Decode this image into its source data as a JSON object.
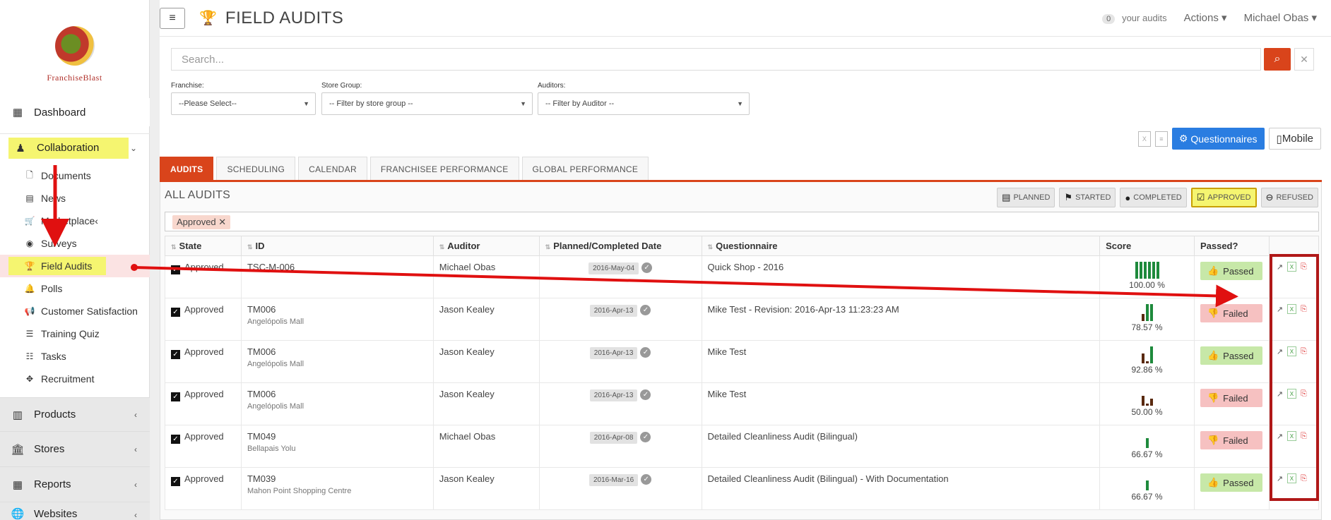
{
  "sidebar": {
    "logo_text": "FranchiseBlast",
    "items": [
      {
        "label": "Dashboard",
        "icon": "dashboard-icon"
      },
      {
        "label": "Collaboration",
        "icon": "collaboration-icon"
      }
    ],
    "sub_items": [
      {
        "label": "Documents",
        "icon": "document-icon"
      },
      {
        "label": "News",
        "icon": "newspaper-icon"
      },
      {
        "label": "Marketplace",
        "icon": "cart-icon"
      },
      {
        "label": "Surveys",
        "icon": "survey-icon"
      },
      {
        "label": "Field Audits",
        "icon": "trophy-icon"
      },
      {
        "label": "Polls",
        "icon": "bell-icon"
      },
      {
        "label": "Customer Satisfaction",
        "icon": "megaphone-icon"
      },
      {
        "label": "Training Quiz",
        "icon": "list-icon"
      },
      {
        "label": "Tasks",
        "icon": "tasks-icon"
      },
      {
        "label": "Recruitment",
        "icon": "crosshair-icon"
      }
    ],
    "sections": [
      {
        "label": "Products",
        "icon": "barcode-icon"
      },
      {
        "label": "Stores",
        "icon": "bank-icon"
      },
      {
        "label": "Reports",
        "icon": "table-icon"
      },
      {
        "label": "Websites",
        "icon": "globe-icon"
      }
    ]
  },
  "header": {
    "title": "FIELD AUDITS",
    "audit_count": "0",
    "your_audits": "your audits",
    "actions": "Actions",
    "user": "Michael Obas"
  },
  "search": {
    "placeholder": "Search..."
  },
  "filters": [
    {
      "label": "Franchise:",
      "value": "--Please Select--"
    },
    {
      "label": "Store Group:",
      "value": "-- Filter by store group --"
    },
    {
      "label": "Auditors:",
      "value": "-- Filter by Auditor --"
    }
  ],
  "toolbar": {
    "questionnaires": "Questionnaires",
    "mobile": "Mobile"
  },
  "tabs": [
    "AUDITS",
    "SCHEDULING",
    "CALENDAR",
    "FRANCHISEE PERFORMANCE",
    "GLOBAL PERFORMANCE"
  ],
  "panel": {
    "title": "ALL AUDITS",
    "status_filters": [
      "PLANNED",
      "STARTED",
      "COMPLETED",
      "APPROVED",
      "REFUSED"
    ],
    "active_tag": "Approved"
  },
  "table": {
    "columns": [
      "State",
      "ID",
      "Auditor",
      "Planned/Completed Date",
      "Questionnaire",
      "Score",
      "Passed?"
    ],
    "rows": [
      {
        "state": "Approved",
        "id": "TSC-M-006",
        "store": "",
        "auditor": "Michael Obas",
        "date": "2016-May-04",
        "questionnaire": "Quick Shop - 2016",
        "score": "100.00 %",
        "passed": "Passed"
      },
      {
        "state": "Approved",
        "id": "TM006",
        "store": "Angelópolis Mall",
        "auditor": "Jason Kealey",
        "date": "2016-Apr-13",
        "questionnaire": "Mike Test - Revision: 2016-Apr-13 11:23:23 AM",
        "score": "78.57 %",
        "passed": "Failed"
      },
      {
        "state": "Approved",
        "id": "TM006",
        "store": "Angelópolis Mall",
        "auditor": "Jason Kealey",
        "date": "2016-Apr-13",
        "questionnaire": "Mike Test",
        "score": "92.86 %",
        "passed": "Passed"
      },
      {
        "state": "Approved",
        "id": "TM006",
        "store": "Angelópolis Mall",
        "auditor": "Jason Kealey",
        "date": "2016-Apr-13",
        "questionnaire": "Mike Test",
        "score": "50.00 %",
        "passed": "Failed"
      },
      {
        "state": "Approved",
        "id": "TM049",
        "store": "Bellapais Yolu",
        "auditor": "Michael Obas",
        "date": "2016-Apr-08",
        "questionnaire": "Detailed Cleanliness Audit (Bilingual)",
        "score": "66.67 %",
        "passed": "Failed"
      },
      {
        "state": "Approved",
        "id": "TM039",
        "store": "Mahon Point Shopping Centre",
        "auditor": "Jason Kealey",
        "date": "2016-Mar-16",
        "questionnaire": "Detailed Cleanliness Audit (Bilingual) - With Documentation",
        "score": "66.67 %",
        "passed": "Passed"
      }
    ]
  },
  "colors": {
    "accent": "#d9441b",
    "primary_button": "#2a7de1",
    "highlight": "#f5f570",
    "annotation_red": "#e01010",
    "passed_bg": "#c7e8a8",
    "failed_bg": "#f6c1c1"
  }
}
